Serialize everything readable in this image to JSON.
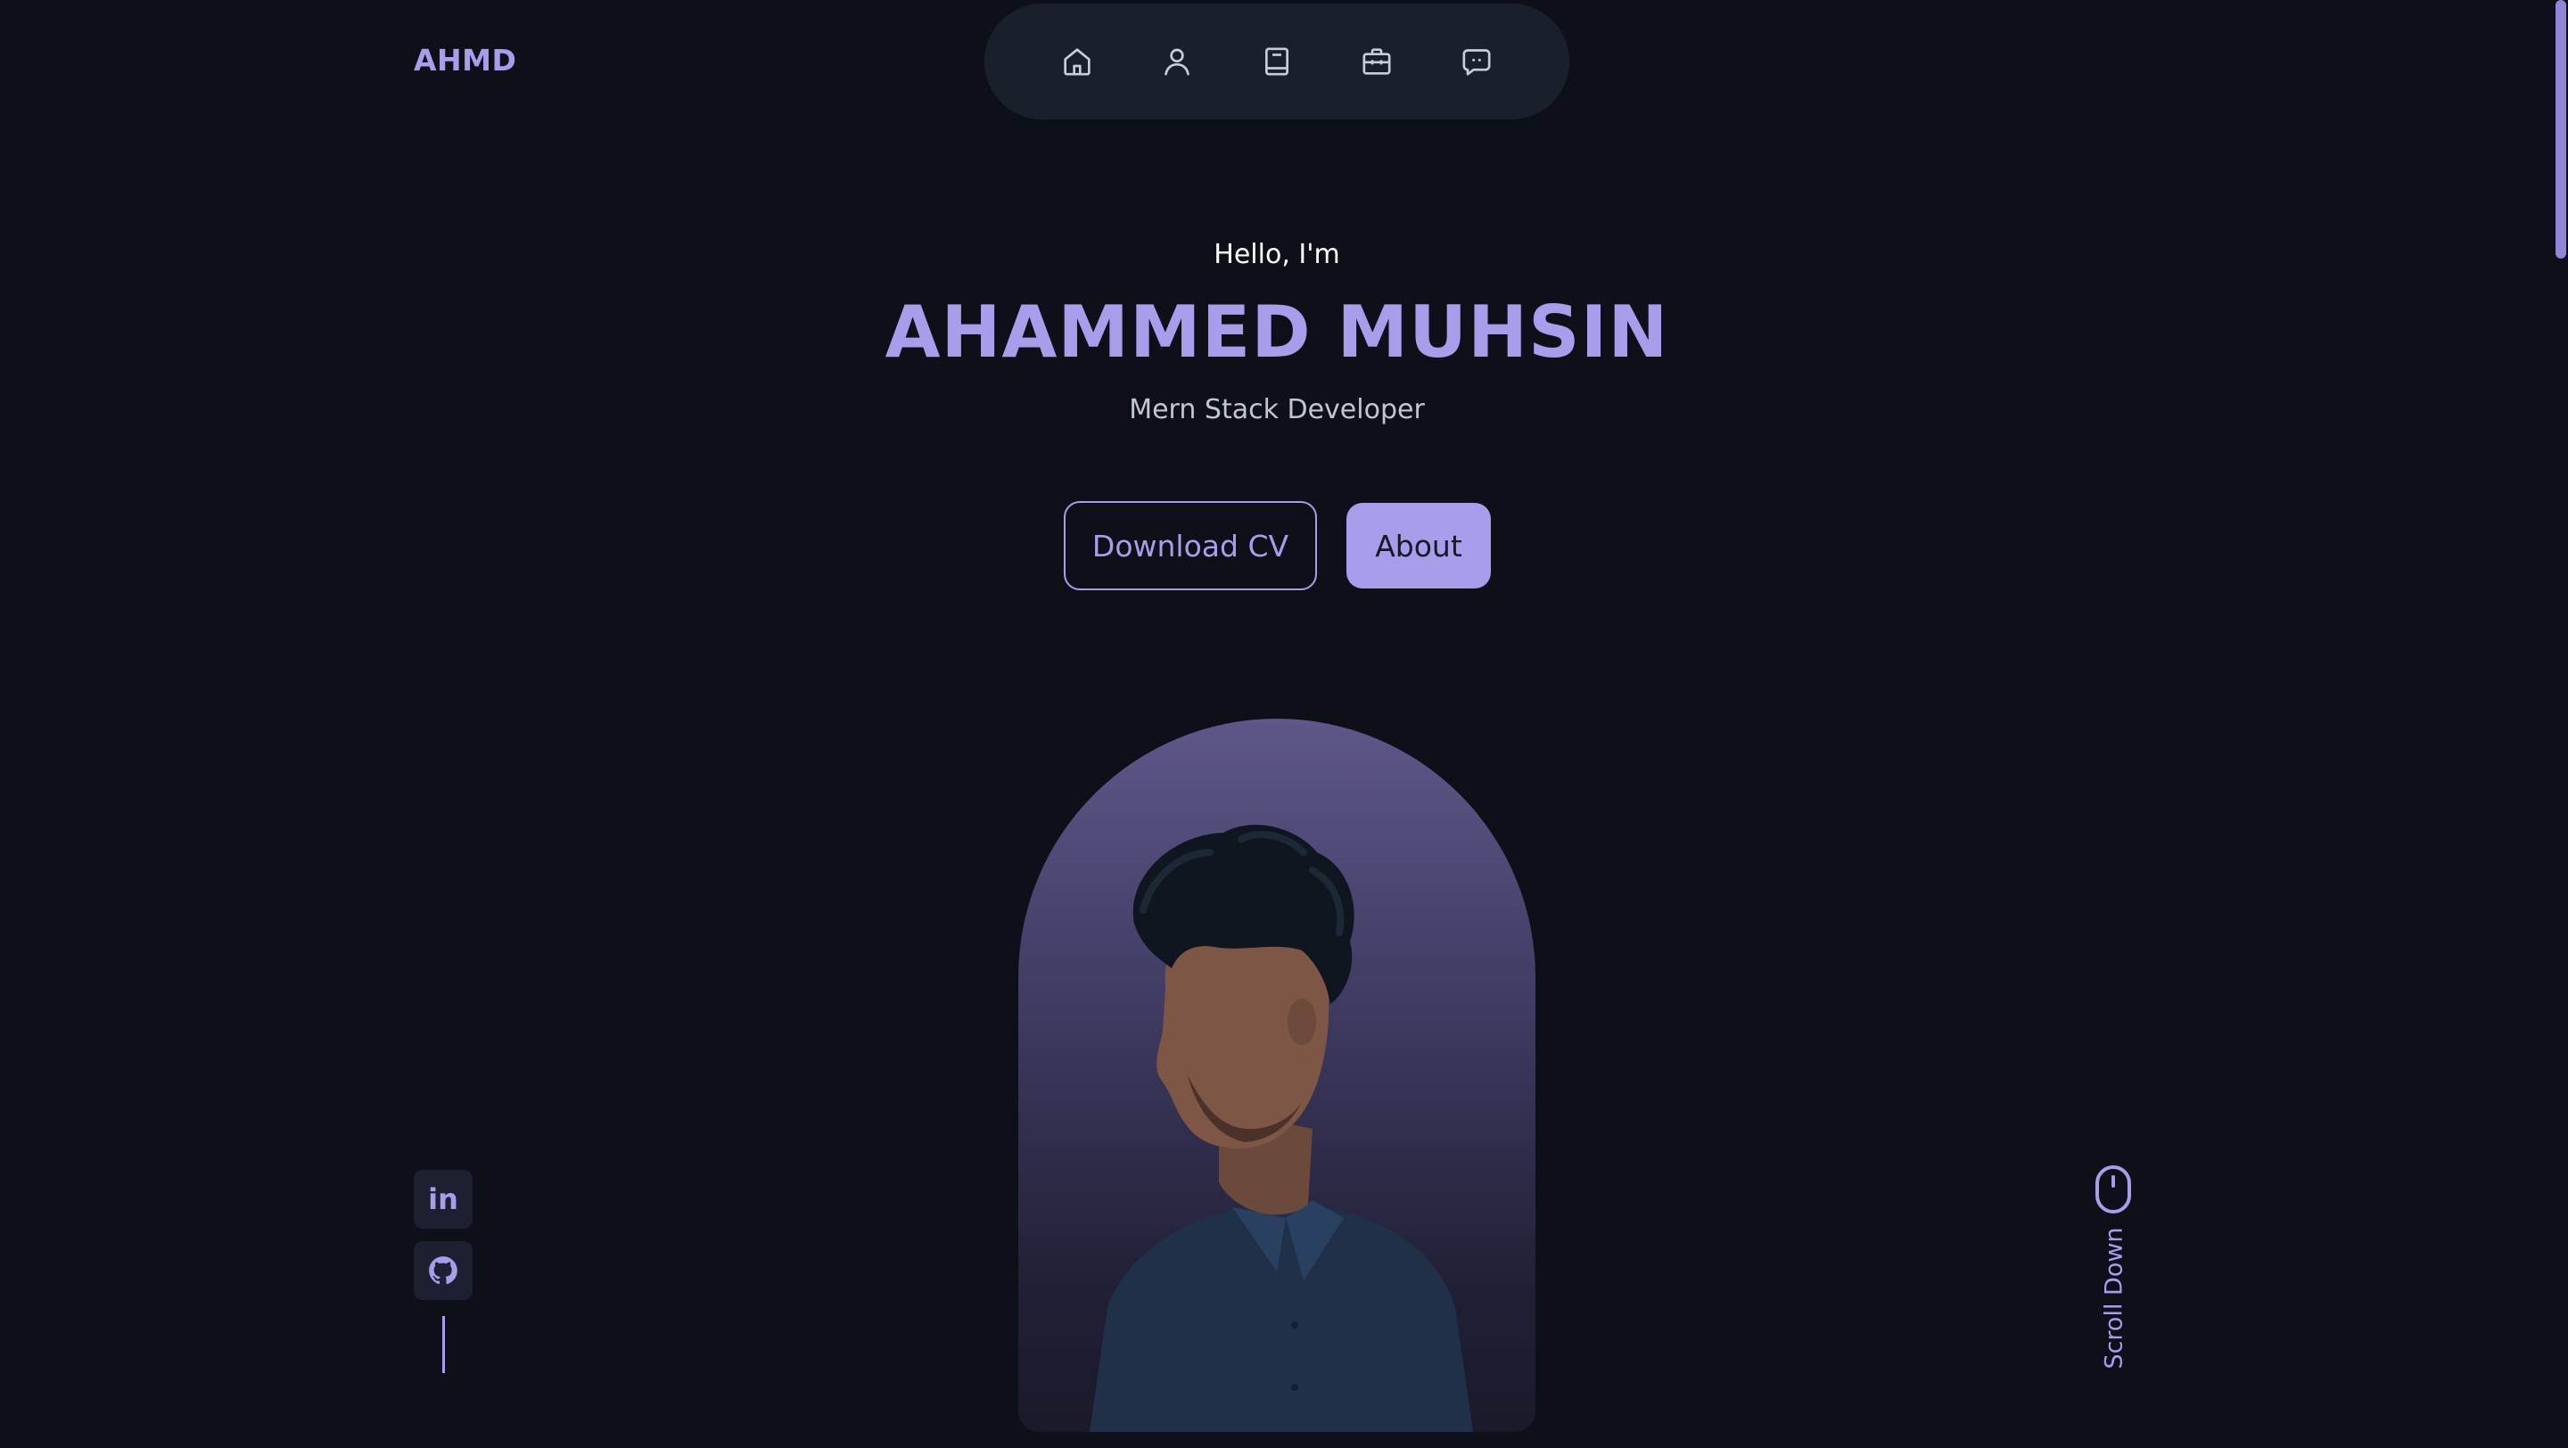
{
  "logo": "AHMD",
  "nav": {
    "items": [
      {
        "icon": "home-icon"
      },
      {
        "icon": "user-icon"
      },
      {
        "icon": "book-icon"
      },
      {
        "icon": "briefcase-icon"
      },
      {
        "icon": "message-icon"
      }
    ]
  },
  "hero": {
    "greeting": "Hello, I'm",
    "name": "AHAMMED MUHSIN",
    "role": "Mern Stack Developer",
    "download_cv_label": "Download CV",
    "about_label": "About"
  },
  "social": [
    {
      "icon": "linkedin-icon",
      "glyph": "in"
    },
    {
      "icon": "github-icon"
    }
  ],
  "scroll": {
    "label": "Scroll Down",
    "icon": "mouse-icon"
  },
  "colors": {
    "background": "#0d1019",
    "accent": "#a79eeb",
    "nav_background": "#1a1f2c",
    "button_text_dark": "#161a26"
  }
}
